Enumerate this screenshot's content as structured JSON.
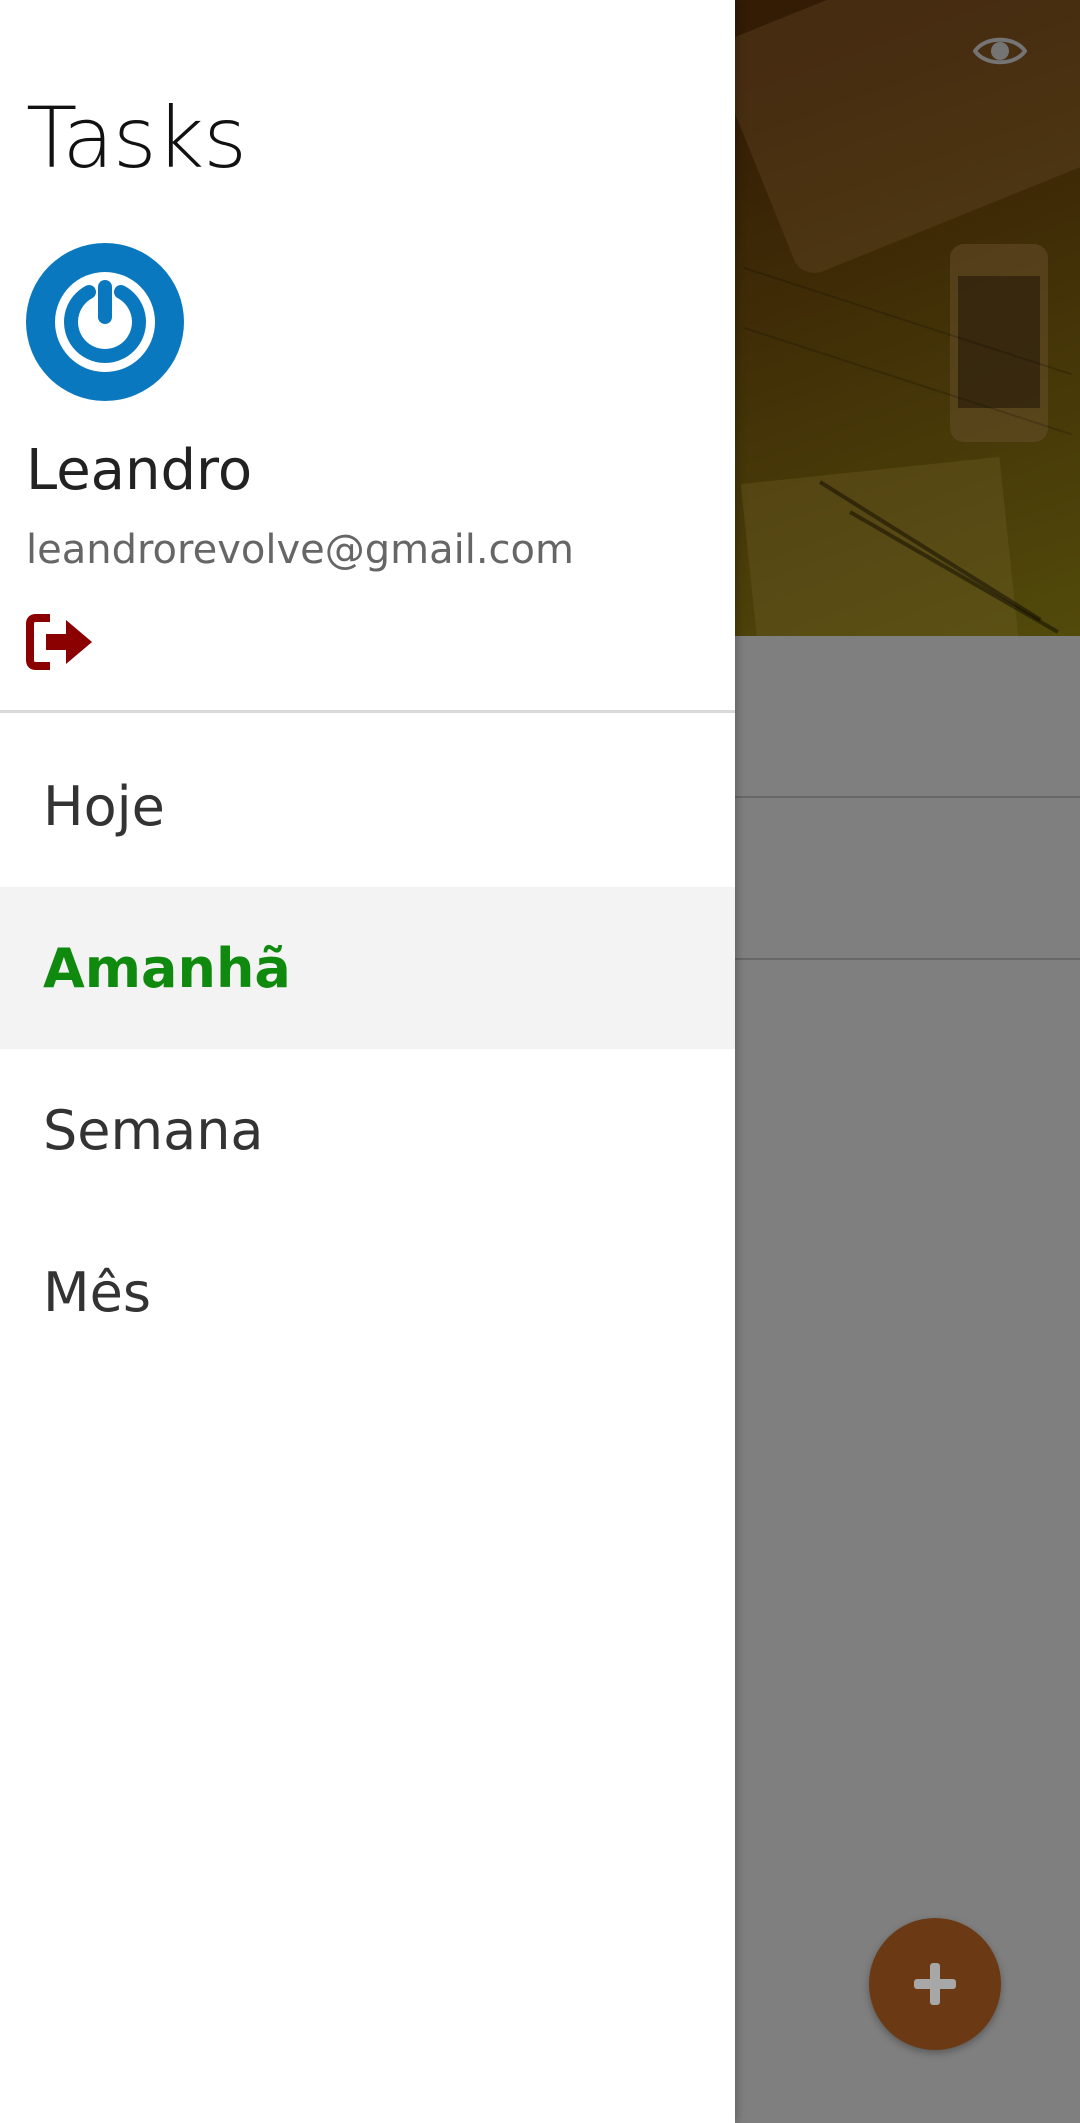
{
  "header": {
    "title": "Tasks",
    "user_name": "Leandro",
    "user_email": "leandrorevolve@gmail.com"
  },
  "nav": {
    "items": [
      {
        "label": "Hoje",
        "active": false
      },
      {
        "label": "Amanhã",
        "active": true
      },
      {
        "label": "Semana",
        "active": false
      },
      {
        "label": "Mês",
        "active": false
      }
    ]
  },
  "icons": {
    "avatar": "power-logo-icon",
    "logout": "logout-icon",
    "visibility": "eye-icon",
    "add": "plus-icon"
  },
  "colors": {
    "active_item": "#0f8a0f",
    "active_bg": "#f3f3f3",
    "avatar_bg": "#0a78bf",
    "logout": "#8b0000",
    "fab": "#6b3a14"
  }
}
